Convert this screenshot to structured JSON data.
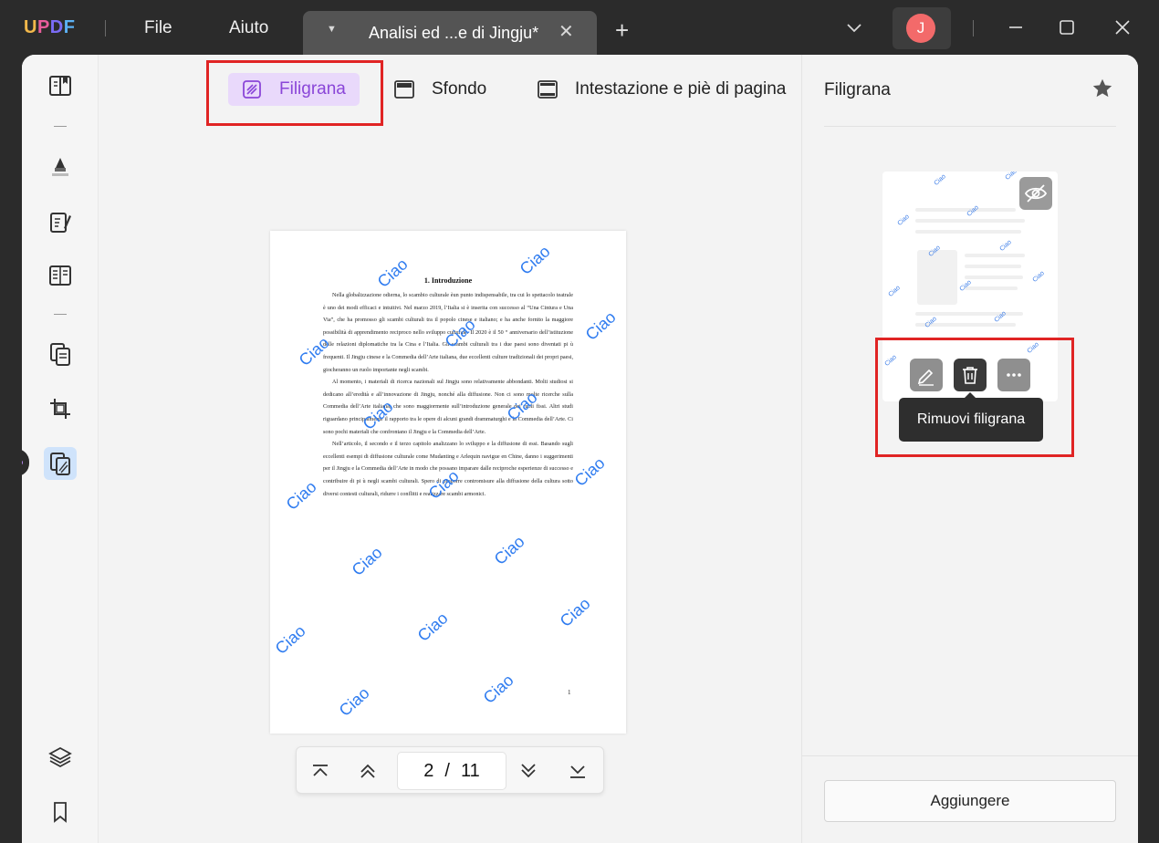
{
  "titlebar": {
    "logo": {
      "u": "U",
      "p": "P",
      "d": "D",
      "f": "F"
    },
    "menu": [
      "File",
      "Aiuto"
    ],
    "tab_title": "Analisi ed ...e di Jingju*",
    "avatar_initial": "J"
  },
  "toolbar": {
    "filigrana": "Filigrana",
    "sfondo": "Sfondo",
    "intestazione": "Intestazione e piè di pagina"
  },
  "document": {
    "title": "1. Introduzione",
    "paragraphs": [
      "Nella globalizzazione odierna, lo scambio culturale èun punto indispensabile, tra cui lo spettacolo teatrale è uno dei modi efficaci e intuitivi. Nel marzo 2019, l’Italia si è inserita con successo al “Una Cintura e Una Via”, che ha promosso gli scambi culturali tra il popolo cinese e italiano; e ha anche fornito la maggiore possibilità di apprendimento reciproco nello sviluppo culturale. Il 2020 è il 50 “ anniversario dell’istituzione delle relazioni diplomatiche tra la Cina e l’Italia. Gli scambi culturali tra i due paesi sono diventati pi ù frequenti. Il Jingju cinese e la Commedia dell’Arte italiana, due eccellenti culture tradizionali dei propri paesi, giocheranno un ruolo importante negli scambi.",
      "Al momento, i materiali di ricerca nazionali sul Jingju sono relativamente abbondanti. Molti studiosi si dedicano all’eredità e all’innovazione di Jingju, nonché alla diffusione. Non ci sono molte ricerche sulla Commedia dell’Arte italiana, che sono maggiormente sull’introduzione generale dei ruoli fissi. Altri studi riguardano principalmente il rapporto tra le opere di alcuni grandi drammaturghi e la Commedia dell’Arte. Ci sono pochi materiali che confrontano il Jingju e la Commedia dell’Arte.",
      "Nell’articolo, il secondo e il terzo capitolo analizzano lo sviluppo e la diffusione di essi. Basando sugli eccellenti esempi di diffusione culturale come Mudanting e Arlequin navigue en Chine, danno i suggerimenti per il Jingju e la Commedia dell’Arte in modo che possano imparare dalle reciproche esperienze di successo e contribuire di pi ù negli scambi culturali. Spero di proporre contromisure alla diffusione della cultura sotto diversi contesti culturali, ridurre i conflitti e realizzare scambi armonici."
    ],
    "page_number": "1",
    "watermark_text": "Ciao"
  },
  "pager": {
    "current": "2",
    "separator": "/",
    "total": "11"
  },
  "right_panel": {
    "title": "Filigrana",
    "thumb_watermark": "Ciao",
    "tooltip": "Rimuovi filigrana",
    "add_button": "Aggiungere"
  },
  "colors": {
    "accent_purple": "#8a46d8",
    "highlight_red": "#e02424",
    "watermark_blue": "#2f7cf0"
  }
}
